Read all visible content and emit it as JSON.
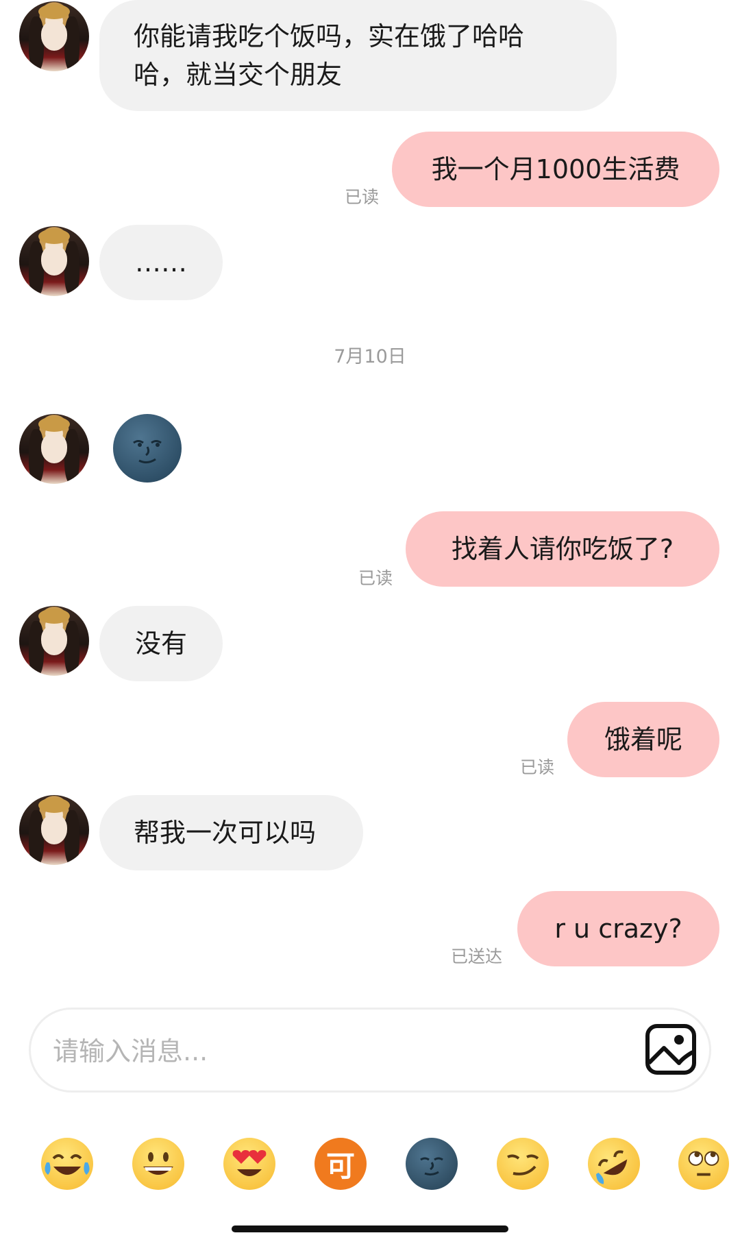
{
  "messages": [
    {
      "id": "m1",
      "side": "in",
      "text_line1": "你能请我吃个饭吗，实在饿了哈哈",
      "text_line2": "哈，就当交个朋友"
    },
    {
      "id": "m2",
      "side": "out",
      "text": "我一个月1000生活费",
      "status": "已读"
    },
    {
      "id": "m3",
      "side": "in",
      "text": "……"
    },
    {
      "id": "m4",
      "side": "in",
      "emoji": "new-moon-face"
    },
    {
      "id": "m5",
      "side": "out",
      "text": "找着人请你吃饭了?",
      "status": "已读"
    },
    {
      "id": "m6",
      "side": "in",
      "text": "没有"
    },
    {
      "id": "m7",
      "side": "out",
      "text": "饿着呢",
      "status": "已读"
    },
    {
      "id": "m8",
      "side": "in",
      "text": "帮我一次可以吗"
    },
    {
      "id": "m9",
      "side": "out",
      "text": "r u crazy?",
      "status": "已送达"
    }
  ],
  "date_divider": "7月10日",
  "composer": {
    "placeholder": "请输入消息...",
    "image_icon": "image-icon"
  },
  "emoji_bar": [
    {
      "name": "tears-of-joy"
    },
    {
      "name": "grinning-face"
    },
    {
      "name": "heart-eyes"
    },
    {
      "name": "ke-badge",
      "label": "可"
    },
    {
      "name": "new-moon-face"
    },
    {
      "name": "smirking-face"
    },
    {
      "name": "rolling-on-floor-laughing"
    },
    {
      "name": "eye-roll"
    }
  ],
  "colors": {
    "incoming_bubble": "#f1f1f1",
    "outgoing_bubble": "#fdc6c6",
    "status_text": "#9a9a9a"
  }
}
